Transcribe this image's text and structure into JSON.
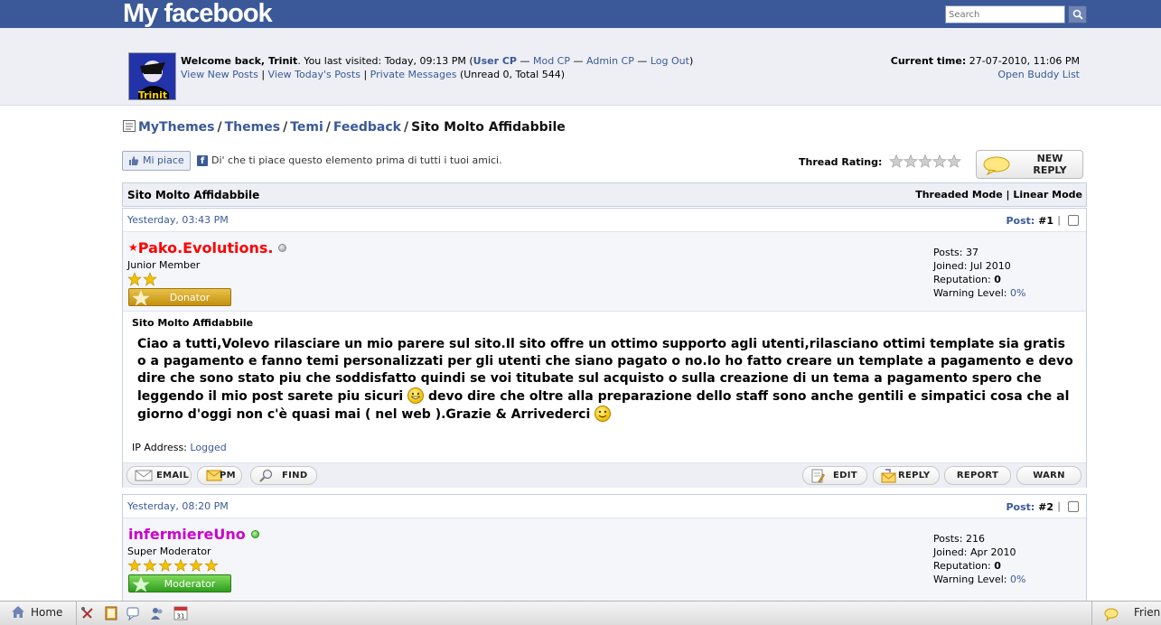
{
  "topbar": {
    "logo": "My facebook",
    "search_placeholder": "Search"
  },
  "header": {
    "avatar_text": "Trinit",
    "welcome_prefix": "Welcome back, ",
    "username": "Trinit",
    "visited_text": ". You last visited: Today, 09:13 PM (",
    "user_cp": "User CP",
    "sep1": " — ",
    "mod_cp": "Mod CP",
    "sep2": " — ",
    "admin_cp": "Admin CP",
    "sep3": " — ",
    "log_out": "Log Out",
    "close_paren": ")",
    "view_new_posts": "View New Posts",
    "pipe1": " | ",
    "view_todays_posts": "View Today's Posts",
    "pipe2": " | ",
    "private_messages": "Private Messages",
    "pm_counts": " (Unread 0, Total 544)",
    "current_time_label": "Current time:",
    "current_time_value": " 27-07-2010, 11:06 PM",
    "open_buddy_list": "Open Buddy List"
  },
  "breadcrumb": {
    "items": [
      "MyThemes",
      "Themes",
      "Temi",
      "Feedback"
    ],
    "separator": "/",
    "current": "Sito Molto Affidabbile"
  },
  "like_row": {
    "like_button": "Mi piace",
    "fb_badge": "f",
    "text": "Di' che ti piace questo elemento prima di tutti i tuoi amici.",
    "rating_label": "Thread Rating:",
    "rating_stars": 0,
    "new_reply_label": "NEW REPLY"
  },
  "thread": {
    "title": "Sito Molto Affidabbile",
    "threaded_mode": "Threaded Mode",
    "mode_sep": " | ",
    "linear_mode": "Linear Mode"
  },
  "posts": [
    {
      "date": "Yesterday, 03:43 PM",
      "post_label": "Post:",
      "post_number": " #1",
      "pipe": "|",
      "author": "Pako.Evolutions.",
      "author_prefix": "★",
      "author_color": "#ff0000",
      "online": false,
      "user_title": "Junior Member",
      "star_count": 2,
      "rank_label": "Donator",
      "rank_color": "#d09a20",
      "posts_label": "Posts:",
      "posts_value": " 37",
      "joined_label": "Joined:",
      "joined_value": " Jul 2010",
      "reputation_label": "Reputation:",
      "reputation_value": "0",
      "warning_label": "Warning Level:",
      "warning_value": "0%",
      "subject": "Sito Molto Affidabbile",
      "body_part1": "Ciao a tutti,Volevo rilasciare un mio parere sul sito.Il sito offre un ottimo supporto agli utenti,rilasciano ottimi template sia gratis o a pagamento e fanno temi personalizzati per gli utenti che siano pagato o no.Io ho fatto creare un template a pagamento e devo dire che sono stato piu che soddisfatto quindi se voi titubate sul acquisto o sulla creazione di un tema a pagamento spero che leggendo il mio post sarete piu sicuri",
      "body_part2": " devo dire che oltre alla preparazione dello staff sono anche gentili e simpatici cosa che al giorno d'oggi non c'è quasi mai ( nel web ).Grazie & Arrivederci ",
      "ip_label": "IP Address:",
      "ip_value": "Logged",
      "buttons": {
        "email": "EMAIL",
        "pm": "PM",
        "find": "FIND",
        "edit": "EDIT",
        "reply": "REPLY",
        "report": "REPORT",
        "warn": "WARN"
      }
    },
    {
      "date": "Yesterday, 08:20 PM",
      "post_label": "Post:",
      "post_number": " #2",
      "pipe": "|",
      "author": "infermiereUno",
      "author_color": "#cc00cc",
      "online": true,
      "user_title": "Super Moderator",
      "star_count": 6,
      "rank_label": "Moderator",
      "rank_color": "#3aaa2a",
      "posts_label": "Posts:",
      "posts_value": " 216",
      "joined_label": "Joined:",
      "joined_value": " Apr 2010",
      "reputation_label": "Reputation:",
      "reputation_value": "0",
      "warning_label": "Warning Level:",
      "warning_value": "0%"
    }
  ],
  "bottombar": {
    "home": "Home",
    "friends": "Frien",
    "calendar_day": "31",
    "icons": [
      "tools-icon",
      "notes-icon",
      "chat-icon",
      "friends-icon",
      "calendar-icon"
    ]
  },
  "colors": {
    "brand": "#3b5998",
    "header_bg": "#edeff4"
  }
}
